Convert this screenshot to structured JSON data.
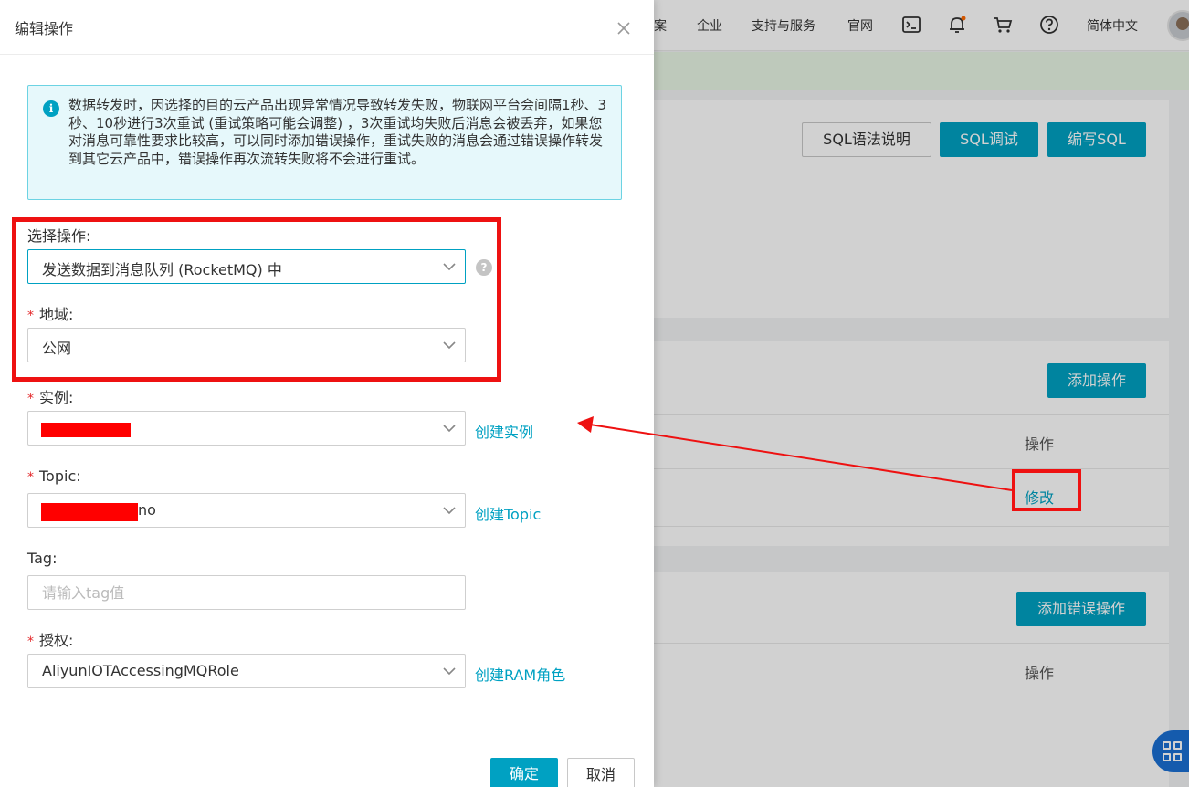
{
  "topnav": {
    "items": [
      "案",
      "企业",
      "支持与服务",
      "官网"
    ],
    "language": "简体中文"
  },
  "card1": {
    "sql_help": "SQL语法说明",
    "sql_debug": "SQL调试",
    "sql_write": "编写SQL"
  },
  "card2": {
    "add_action": "添加操作",
    "col_action": "操作",
    "modify": "修改"
  },
  "card3": {
    "add_error_action": "添加错误操作",
    "col_action": "操作"
  },
  "drawer": {
    "title": "编辑操作",
    "notice": "数据转发时，因选择的目的云产品出现异常情况导致转发失败，物联网平台会间隔1秒、3秒、10秒进行3次重试 (重试策略可能会调整) ，3次重试均失败后消息会被丢弃，如果您对消息可靠性要求比较高，可以同时添加错误操作，重试失败的消息会通过错误操作转发到其它云产品中，错误操作再次流转失败将不会进行重试。",
    "required_mark": "*",
    "action_label": "选择操作:",
    "action_value": "发送数据到消息队列 (RocketMQ) 中",
    "region_label": "地域:",
    "region_value": "公网",
    "instance_label": "实例:",
    "instance_link": "创建实例",
    "topic_label": "Topic:",
    "topic_value_suffix": "no",
    "topic_link": "创建Topic",
    "tag_label": "Tag:",
    "tag_placeholder": "请输入tag值",
    "auth_label": "授权:",
    "auth_value": "AliyunIOTAccessingMQRole",
    "auth_link": "创建RAM角色",
    "ok": "确定",
    "cancel": "取消"
  },
  "colors": {
    "primary": "#00a1c2",
    "annotation_red": "#ee1111",
    "required_red": "#e3282a"
  },
  "icons": [
    "close-icon",
    "info-icon",
    "chevron-down-icon",
    "help-icon",
    "terminal-icon",
    "bell-icon",
    "cart-icon",
    "question-icon",
    "grid-icon"
  ]
}
